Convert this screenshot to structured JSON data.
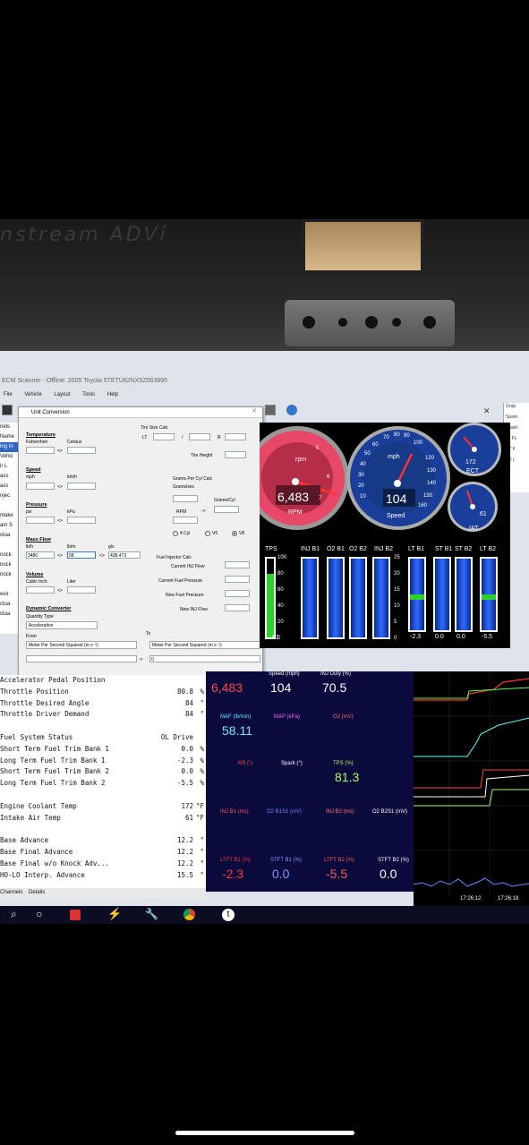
{
  "photo": {
    "brand_text": "nstream ADVi"
  },
  "window": {
    "title": "ECM Scanner - Offline: 2005 Toyota 5TETU62NX5Z063995",
    "menu": [
      "File",
      "Vehicle",
      "Layout",
      "Tools",
      "Help"
    ]
  },
  "right_pane": {
    "header": "Grap",
    "items": [
      "Spark",
      "Spark",
      "LT FL",
      "ST F",
      "O2 ("
    ]
  },
  "left_list": [
    "nels",
    "Name",
    "ing In",
    "Vehic",
    "ir L",
    "ass",
    "ass",
    "njec",
    "",
    "ntake",
    "am S",
    "ctua",
    "",
    "nock",
    "nock",
    "nock",
    "",
    "esir",
    "ctua",
    "ctua"
  ],
  "dialog": {
    "title": "Unit Conversion",
    "temperature": {
      "header": "Temperature",
      "from": "Fahrenheit",
      "to": "Celsius",
      "arrow": "<>"
    },
    "speed": {
      "header": "Speed",
      "from": "mph",
      "to": "km/h",
      "arrow": "<>"
    },
    "pressure": {
      "header": "Pressure",
      "from": "psi",
      "to": "kPa",
      "arrow": "<>"
    },
    "mass_flow": {
      "header": "Mass Flow",
      "col1": "lb/h",
      "col2": "lb/m",
      "col3": "g/s",
      "val1": "3480",
      "val2": "58",
      "val3": "438.473",
      "arrow1": "<>",
      "arrow2": "<>"
    },
    "volume": {
      "header": "Volume",
      "from": "Cubic Inch",
      "to": "Liter",
      "arrow": "<>"
    },
    "dynamic": {
      "header": "Dynamic Converter",
      "qtype_label": "Quantity Type",
      "qtype": "Acceleration",
      "from_label": "From",
      "to_label": "To",
      "from_unit": "Meter Per Second Squared (m s⁻²)",
      "to_unit": "Meter Per Second Squared (m s⁻²)",
      "to_value": "0",
      "arrow": "->"
    },
    "tire": {
      "header": "Tire Size Calc",
      "lt": "LT",
      "slash": "/",
      "r": "R",
      "height": "Tire Height"
    },
    "grams": {
      "header": "Grams Per Cyl Calc",
      "gs": "Grams/sec",
      "gcyl": "Grams/Cyl",
      "rpm": "RPM",
      "arrow": "->",
      "opt1": "4 Cyl",
      "opt2": "V6",
      "opt3": "V8"
    },
    "injector": {
      "header": "Fuel Injector Calc",
      "l1": "Current INJ Flow",
      "l2": "Current Fuel Pressure",
      "l3": "New Fuel Pressure",
      "l4": "New INJ Flow"
    }
  },
  "dashboard": {
    "tach": {
      "value": "6,483",
      "unit": "rpm",
      "label": "RPM",
      "ticks": [
        "1",
        "2",
        "3",
        "4",
        "5",
        "6",
        "7"
      ]
    },
    "speedo": {
      "value": "104",
      "unit": "mph",
      "label": "Speed",
      "ticks": [
        "10",
        "20",
        "30",
        "40",
        "50",
        "60",
        "70",
        "80",
        "90",
        "100",
        "110",
        "120",
        "130",
        "140",
        "150",
        "160"
      ]
    },
    "ect": {
      "value": "172",
      "label": "ECT"
    },
    "iat": {
      "value": "61",
      "label": "IAT"
    },
    "bar_labels": [
      "TPS",
      "INJ B1",
      "O2 B1",
      "O2 B2",
      "INJ B2",
      "LT B1",
      "ST B1",
      "ST B2",
      "LT B2"
    ],
    "bar_scale": [
      "100",
      "80",
      "60",
      "40",
      "20",
      "0"
    ],
    "bar_scale2": [
      "25",
      "20",
      "15",
      "10",
      "5",
      "0"
    ],
    "tps_value": "81",
    "lt_values": [
      "-2.3",
      "0.0",
      "0.0",
      "-5.5"
    ]
  },
  "data_table": [
    {
      "name": "Accelerator Pedal Position",
      "value": "",
      "unit": ""
    },
    {
      "name": "Throttle Position",
      "value": "80.8",
      "unit": "%"
    },
    {
      "name": "Throttle Desired Angle",
      "value": "84",
      "unit": "°"
    },
    {
      "name": "Throttle Driver Demand",
      "value": "84",
      "unit": "°"
    },
    {
      "name": "",
      "value": "",
      "unit": ""
    },
    {
      "name": "Fuel System Status",
      "value": "OL Drive",
      "unit": ""
    },
    {
      "name": "Short Term Fuel Trim Bank 1",
      "value": "0.0",
      "unit": "%"
    },
    {
      "name": "Long Term Fuel Trim Bank 1",
      "value": "-2.3",
      "unit": "%"
    },
    {
      "name": "Short Term Fuel Trim Bank 2",
      "value": "0.0",
      "unit": "%"
    },
    {
      "name": "Long Term Fuel Trim Bank 2",
      "value": "-5.5",
      "unit": "%"
    },
    {
      "name": "",
      "value": "",
      "unit": ""
    },
    {
      "name": "Engine Coolant Temp",
      "value": "172",
      "unit": "°F"
    },
    {
      "name": "Intake Air Temp",
      "value": "61",
      "unit": "°F"
    },
    {
      "name": "",
      "value": "",
      "unit": ""
    },
    {
      "name": "Base Advance",
      "value": "12.2",
      "unit": "°"
    },
    {
      "name": "Base Final Advance",
      "value": "12.2",
      "unit": "°"
    },
    {
      "name": "Base Final w/o Knock Adv...",
      "value": "12.2",
      "unit": "°"
    },
    {
      "name": "HO-LO Interp. Advance",
      "value": "15.5",
      "unit": "°"
    }
  ],
  "table_tabs": [
    "Channels",
    "Details"
  ],
  "gauges_panel": {
    "rpm": {
      "label": "",
      "value": "6,483",
      "color": "#ff4444"
    },
    "speed": {
      "label": "Speed (mph)",
      "value": "104",
      "color": "#ffffff"
    },
    "inj_duty": {
      "label": "INJ Duty (%)",
      "value": "70.5",
      "color": "#ffffff"
    },
    "maf": {
      "label": "MAF (lb/min)",
      "value": "58.11",
      "color": "#6ee8ff"
    },
    "map": {
      "label": "MAP (kPa)",
      "value": "",
      "color": "#ff66ff"
    },
    "o2": {
      "label": "O2 (mV)",
      "value": "",
      "color": "#ff6666"
    },
    "kr": {
      "label": "KR (°)",
      "value": "",
      "color": "#ff4444"
    },
    "spark": {
      "label": "Spark (°)",
      "value": "",
      "color": "#ffffff"
    },
    "tps": {
      "label": "TPS (%)",
      "value": "81.3",
      "color": "#aaff55"
    },
    "injb1": {
      "label": "INJ B1 (ms)",
      "value": "",
      "color": "#ff5555"
    },
    "o2b1s1": {
      "label": "O2 B1S1 (mV)",
      "value": "",
      "color": "#6688ff"
    },
    "injb2": {
      "label": "INJ B2 (ms)",
      "value": "",
      "color": "#ff7777"
    },
    "o2b2s1": {
      "label": "O2 B2S1 (mV)",
      "value": "",
      "color": "#ffffff"
    },
    "ltft1": {
      "label": "LTFT B1 (%)",
      "value": "-2.3",
      "color": "#ff3333"
    },
    "stft1": {
      "label": "STFT B1 (%)",
      "value": "0.0",
      "color": "#8899ff"
    },
    "ltft2": {
      "label": "LTFT B2 (%)",
      "value": "-5.5",
      "color": "#ff5555"
    },
    "stft2": {
      "label": "STFT B2 (%)",
      "value": "0.0",
      "color": "#ffffff"
    }
  },
  "graph": {
    "times": [
      "17:26:12",
      "17:26:18"
    ]
  }
}
